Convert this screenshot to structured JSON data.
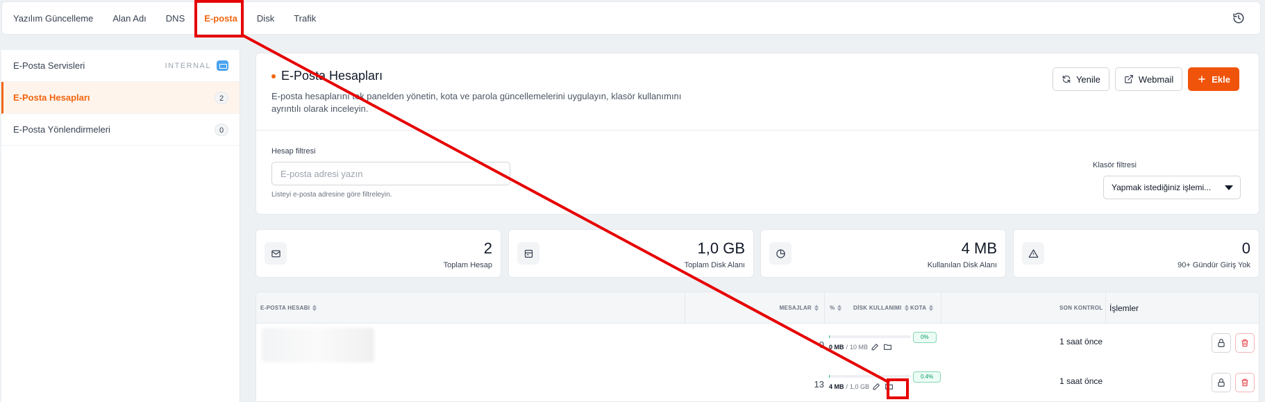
{
  "topnav": {
    "tabs": [
      {
        "label": "Yazılım Güncelleme"
      },
      {
        "label": "Alan Adı"
      },
      {
        "label": "DNS"
      },
      {
        "label": "E-posta"
      },
      {
        "label": "Disk"
      },
      {
        "label": "Trafik"
      }
    ],
    "active_tab": "E-posta",
    "history_icon": "history-icon"
  },
  "sidebar": {
    "items": [
      {
        "label": "E-Posta Servisleri",
        "tag": "INTERNAL"
      },
      {
        "label": "E-Posta Hesapları",
        "count": "2"
      },
      {
        "label": "E-Posta Yönlendirmeleri",
        "count": "0"
      }
    ]
  },
  "main": {
    "title": "E-Posta Hesapları",
    "description": "E-posta hesaplarını tek panelden yönetin, kota ve parola güncellemelerini uygulayın, klasör kullanımını ayrıntılı olarak inceleyin.",
    "buttons": {
      "refresh": "Yenile",
      "webmail": "Webmail",
      "add": "Ekle"
    },
    "account_filter": {
      "label": "Hesap filtresi",
      "placeholder": "E-posta adresi yazın",
      "hint": "Listeyi e-posta adresine göre filtreleyin."
    },
    "folder_filter": {
      "label": "Klasör filtresi",
      "selected": "Yapmak istediğiniz işlemi..."
    }
  },
  "stats": [
    {
      "value": "2",
      "label": "Toplam Hesap",
      "icon": "mail-icon"
    },
    {
      "value": "1,0 GB",
      "label": "Toplam Disk Alanı",
      "icon": "storage-icon"
    },
    {
      "value": "4 MB",
      "label": "Kullanılan Disk Alanı",
      "icon": "pie-icon"
    },
    {
      "value": "0",
      "label": "90+ Gündür Giriş Yok",
      "icon": "warning-icon"
    }
  ],
  "table": {
    "headers": {
      "account": "E-POSTA HESABI",
      "messages": "MESAJLAR",
      "percent": "%",
      "disk": "DİSK KULLANIMI",
      "quota": "KOTA",
      "last_check": "SON KONTROL",
      "actions": "İşlemler"
    },
    "rows": [
      {
        "messages": "0",
        "used": "0 MB",
        "quota": "10 MB",
        "percent_label": "0%",
        "percent": 0,
        "last_check": "1 saat önce"
      },
      {
        "messages": "13",
        "used": "4 MB",
        "quota": "1,0 GB",
        "percent_label": "0.4%",
        "percent": 0.4,
        "last_check": "1 saat önce"
      }
    ]
  },
  "colors": {
    "accent": "#f0650f",
    "annotation": "#e60000",
    "success": "#10b981",
    "danger": "#e5484d"
  }
}
